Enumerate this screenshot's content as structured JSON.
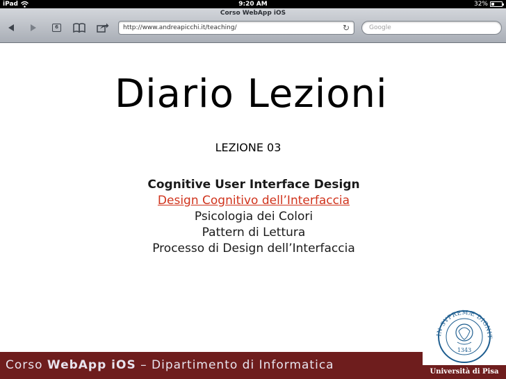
{
  "status_bar": {
    "device": "iPad",
    "time": "9:20 AM",
    "battery": "32%",
    "battery_level": 0.32
  },
  "browser": {
    "page_title": "Corso WebApp iOS",
    "url": "http://www.andreapicchi.it/teaching/",
    "search_placeholder": "Google",
    "tabs_count": "6",
    "back_icon": "back-arrow-icon",
    "forward_icon": "forward-arrow-icon",
    "bookmarks_icon": "book-icon",
    "share_icon": "share-icon",
    "reload_icon": "reload-icon"
  },
  "slide": {
    "title": "Diario Lezioni",
    "lesson": "LEZIONE 03",
    "topics": [
      "Cognitive User Interface Design",
      "Design Cognitivo dell’Interfaccia",
      "Psicologia dei Colori",
      "Pattern di Lettura",
      "Processo di Design dell’Interfaccia"
    ],
    "footer": {
      "prefix": "Corso ",
      "course": "WebApp iOS",
      "suffix": " – Dipartimento di Informatica"
    },
    "logo": {
      "top_text": "IN SVPREMÆ DIGNITATIS",
      "year": "1343",
      "caption": "Università di Pisa"
    }
  },
  "colors": {
    "footer_bg": "#6e1d1d",
    "link": "#d0331c"
  }
}
